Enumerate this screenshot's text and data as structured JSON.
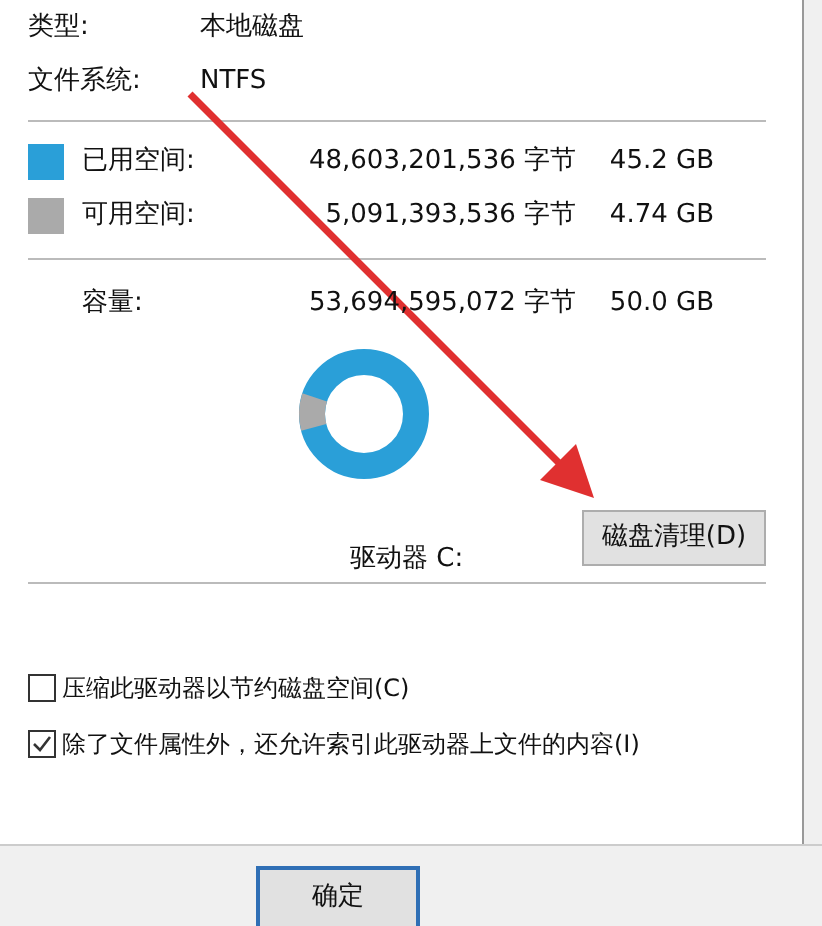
{
  "info": [
    {
      "label": "类型:",
      "value": "本地磁盘"
    },
    {
      "label": "文件系统:",
      "value": "NTFS"
    }
  ],
  "space": [
    {
      "label": "已用空间:",
      "color": "#2a9fd8",
      "bytes": "48,603,201,536 字节",
      "size": "45.2 GB"
    },
    {
      "label": "可用空间:",
      "color": "#aaaaaa",
      "bytes": "5,091,393,536 字节",
      "size": "4.74 GB"
    }
  ],
  "capacity": {
    "label": "容量:",
    "bytes": "53,694,595,072 字节",
    "size": "50.0 GB"
  },
  "drive_label": "驱动器 C:",
  "cleanup_button": "磁盘清理(D)",
  "options": [
    {
      "label": "压缩此驱动器以节约磁盘空间(C)",
      "checked": false
    },
    {
      "label": "除了文件属性外，还允许索引此驱动器上文件的内容(I)",
      "checked": true
    }
  ],
  "buttons": [
    "确定"
  ]
}
